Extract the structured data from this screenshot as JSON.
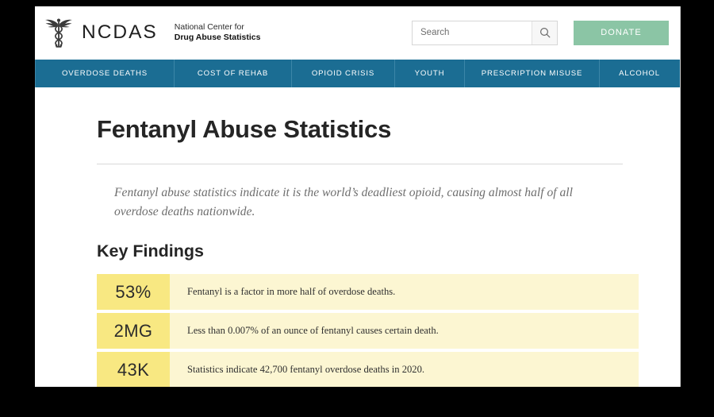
{
  "site": {
    "logo_icon": "caduceus-icon",
    "brand_acronym": "NCDAS",
    "brand_line1": "National Center for",
    "brand_line2": "Drug Abuse Statistics"
  },
  "search": {
    "placeholder": "Search",
    "value": "",
    "icon": "search-icon"
  },
  "donate": {
    "label": "DONATE",
    "color": "#8bc5a5"
  },
  "nav": {
    "background": "#1b6d93",
    "items": [
      {
        "label": "OVERDOSE DEATHS"
      },
      {
        "label": "COST OF REHAB"
      },
      {
        "label": "OPIOID CRISIS"
      },
      {
        "label": "YOUTH"
      },
      {
        "label": "PRESCRIPTION MISUSE"
      },
      {
        "label": "ALCOHOL"
      }
    ]
  },
  "main": {
    "title": "Fentanyl Abuse Statistics",
    "intro": "Fentanyl abuse statistics indicate it is the world’s deadliest opioid, causing almost half of all overdose deaths nationwide.",
    "section_heading": "Key Findings",
    "findings": [
      {
        "stat": "53%",
        "text": "Fentanyl is a factor in more half of overdose deaths."
      },
      {
        "stat": "2MG",
        "text": "Less than 0.007% of an ounce of fentanyl causes certain death."
      },
      {
        "stat": "43K",
        "text": "Statistics indicate 42,700 fentanyl overdose deaths in 2020."
      }
    ],
    "stat_box_color": "#f8e882",
    "stat_row_color": "#fcf6d2"
  }
}
